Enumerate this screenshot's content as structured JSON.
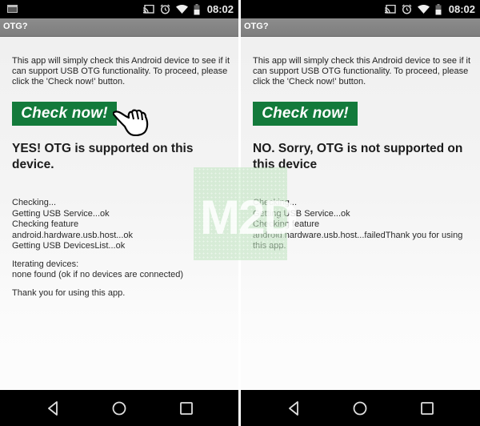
{
  "screens": [
    {
      "status_bar": {
        "time": "08:02",
        "left_icon": "screenshot-notification-icon",
        "icons": [
          "cast-icon",
          "alarm-icon",
          "wifi-icon",
          "battery-icon"
        ]
      },
      "app_title": "OTG?",
      "intro": "This app will simply check this Android device to see if it can support USB OTG functionality. To proceed, please click the 'Check now!' button.",
      "check_button_label": "Check now!",
      "result": "YES! OTG is supported on this device.",
      "log": [
        "Checking...",
        "Getting USB Service...ok",
        "Checking feature",
        "android.hardware.usb.host...ok",
        "Getting USB DevicesList...ok"
      ],
      "iterating": [
        "Iterating devices:",
        "none found (ok if no devices are connected)"
      ],
      "thanks": "Thank you for using this app."
    },
    {
      "status_bar": {
        "time": "08:02",
        "icons": [
          "cast-icon",
          "alarm-icon",
          "wifi-icon",
          "battery-icon"
        ]
      },
      "app_title": "OTG?",
      "intro": "This app will simply check this Android device to see if it can support USB OTG functionality. To proceed, please click the 'Check now!' button.",
      "check_button_label": "Check now!",
      "result": "NO. Sorry, OTG is not supported on this device",
      "log": [
        "Checking...",
        "Getting USB Service...ok",
        "Checking feature",
        "android.hardware.usb.host...failedThank you for using this app."
      ]
    }
  ],
  "watermark": "M2D",
  "colors": {
    "button_green": "#137a3b",
    "action_bar": "#858585",
    "status_bar": "#000000"
  }
}
